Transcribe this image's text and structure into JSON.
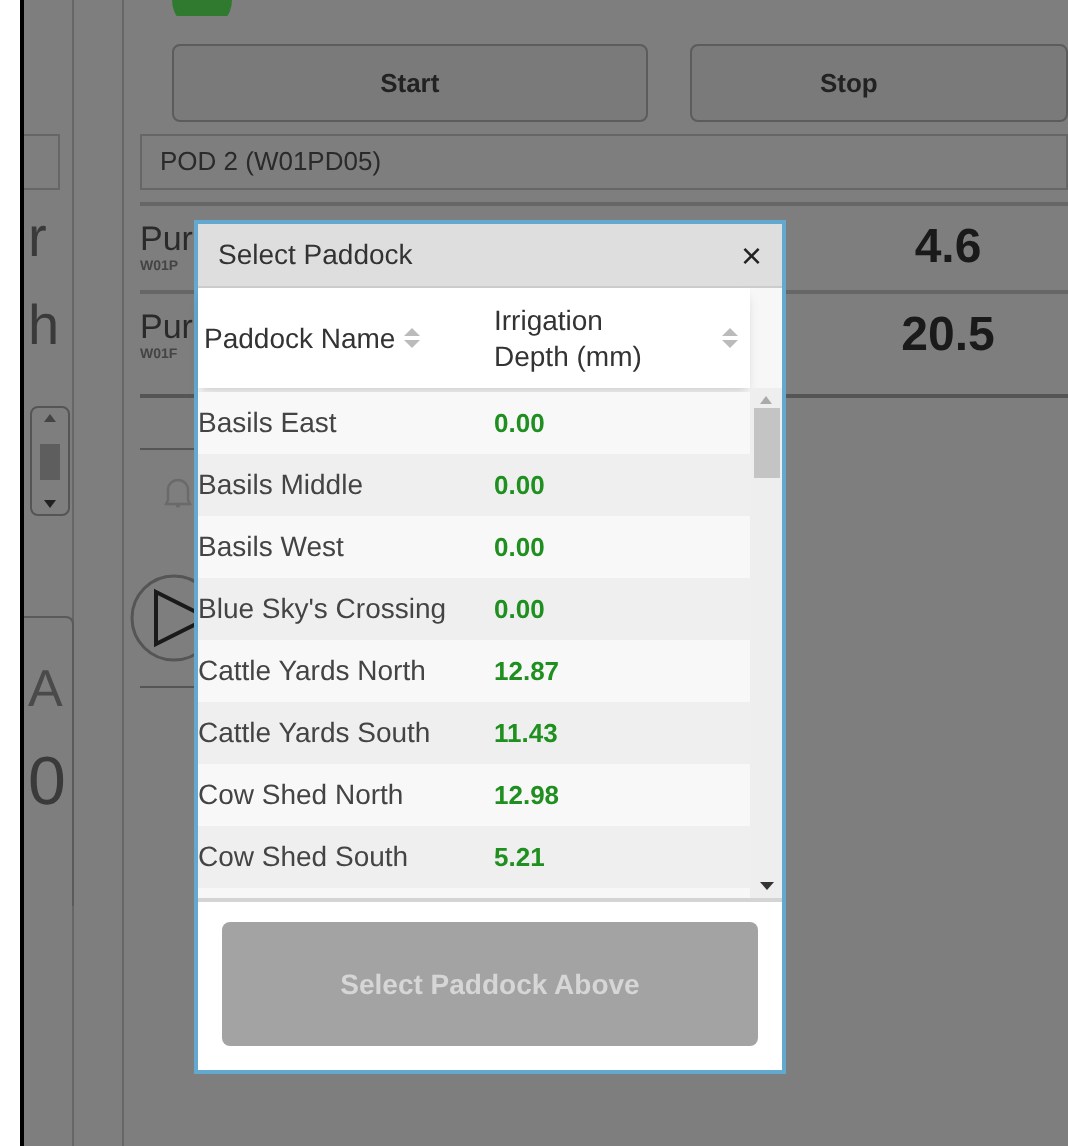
{
  "background": {
    "buttons": [
      {
        "label": "Start"
      },
      {
        "label": "Stop"
      }
    ],
    "dropdown": {
      "value": "POD 2 (W01PD05)"
    },
    "readings": [
      {
        "label": "Pur",
        "code": "W01P",
        "value": "4.6"
      },
      {
        "label": "Pur",
        "code": "W01F",
        "value": "20.5"
      }
    ],
    "side_fragments": [
      "r",
      "h",
      "A",
      "0"
    ]
  },
  "dialog": {
    "title": "Select Paddock",
    "close": "×",
    "columns": [
      {
        "label": "Paddock Name"
      },
      {
        "label": "Irrigation Depth (mm)"
      }
    ],
    "rows": [
      {
        "name": "Basils East",
        "depth": "0.00"
      },
      {
        "name": "Basils Middle",
        "depth": "0.00"
      },
      {
        "name": "Basils West",
        "depth": "0.00"
      },
      {
        "name": "Blue Sky's Crossing",
        "depth": "0.00"
      },
      {
        "name": "Cattle Yards North",
        "depth": "12.87"
      },
      {
        "name": "Cattle Yards South",
        "depth": "11.43"
      },
      {
        "name": "Cow Shed North",
        "depth": "12.98"
      },
      {
        "name": "Cow Shed South",
        "depth": "5.21"
      }
    ],
    "button": {
      "label": "Select Paddock Above",
      "disabled": true
    }
  }
}
